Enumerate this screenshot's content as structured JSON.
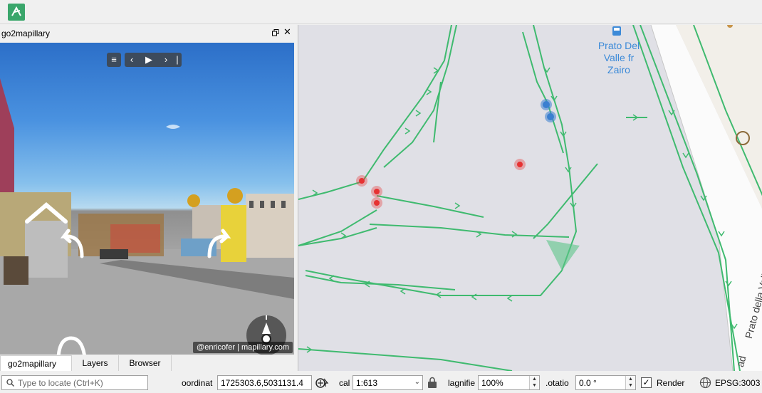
{
  "panel": {
    "title": "go2mapillary",
    "attribution": "@enricofer | mapillary.com"
  },
  "tabs": [
    {
      "label": "go2mapillary"
    },
    {
      "label": "Layers"
    },
    {
      "label": "Browser"
    }
  ],
  "map": {
    "poi_label": "Prato Del\nValle fr\nZairo",
    "road_label": "Prato della Valle",
    "road_label2": "ad",
    "sequence_color": "#3fba6f",
    "marker_red": "#e63232",
    "marker_blue": "#3a7fd0"
  },
  "status": {
    "locate_placeholder": "Type to locate (Ctrl+K)",
    "coordinate_label": "oordinat",
    "coordinate_value": "1725303.6,5031131.4",
    "scale_label": "cal",
    "scale_value": "1:613",
    "magnifier_label": "lagnifie",
    "magnifier_value": "100%",
    "rotation_label": ".otatio",
    "rotation_value": "0.0 °",
    "render_label": "Render",
    "render_checked": "✓",
    "crs_label": "EPSG:3003"
  }
}
